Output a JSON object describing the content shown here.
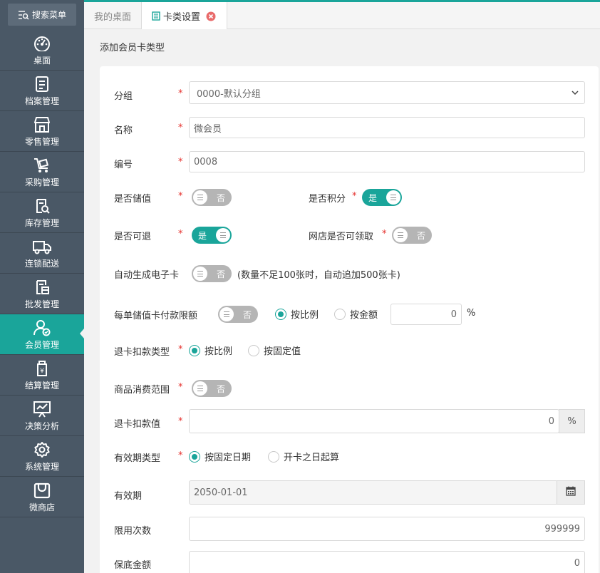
{
  "sidebar": {
    "search_label": "搜索菜单",
    "items": [
      {
        "label": "桌面",
        "icon": "dashboard-icon"
      },
      {
        "label": "档案管理",
        "icon": "archive-icon"
      },
      {
        "label": "零售管理",
        "icon": "store-icon"
      },
      {
        "label": "采购管理",
        "icon": "cart-icon"
      },
      {
        "label": "库存管理",
        "icon": "inventory-icon"
      },
      {
        "label": "连锁配送",
        "icon": "truck-icon"
      },
      {
        "label": "批发管理",
        "icon": "wholesale-icon"
      },
      {
        "label": "会员管理",
        "icon": "member-icon"
      },
      {
        "label": "结算管理",
        "icon": "settlement-icon"
      },
      {
        "label": "决策分析",
        "icon": "analysis-icon"
      },
      {
        "label": "系统管理",
        "icon": "gear-icon"
      },
      {
        "label": "微商店",
        "icon": "shop-bag-icon"
      }
    ],
    "active_index": 7
  },
  "tabs": [
    {
      "label": "我的桌面"
    },
    {
      "label": "卡类设置"
    }
  ],
  "page": {
    "subtitle": "添加会员卡类型"
  },
  "form": {
    "group": {
      "label": "分组",
      "value": "0000-默认分组"
    },
    "name": {
      "label": "名称",
      "value": "微会员"
    },
    "code": {
      "label": "编号",
      "value": "0008"
    },
    "stored_value": {
      "label": "是否储值",
      "state": "否"
    },
    "points": {
      "label": "是否积分",
      "state": "是"
    },
    "refundable": {
      "label": "是否可退",
      "state": "是"
    },
    "online_claim": {
      "label": "网店是否可领取",
      "state": "否"
    },
    "auto_ecard": {
      "label": "自动生成电子卡",
      "state": "否",
      "note": "(数量不足100张时，自动追加500张卡)"
    },
    "payment_limit": {
      "label": "每单储值卡付款限额",
      "state": "否",
      "opt_ratio": "按比例",
      "opt_amount": "按金额",
      "value": "0",
      "unit": "%"
    },
    "refund_deduct_type": {
      "label": "退卡扣款类型",
      "opt_ratio": "按比例",
      "opt_fixed": "按固定值"
    },
    "consume_scope": {
      "label": "商品消费范围",
      "state": "否"
    },
    "refund_deduct_value": {
      "label": "退卡扣款值",
      "value": "0",
      "unit": "%"
    },
    "validity_type": {
      "label": "有效期类型",
      "opt_fixed_date": "按固定日期",
      "opt_from_open": "开卡之日起算"
    },
    "validity": {
      "label": "有效期",
      "value": "2050-01-01"
    },
    "usage_limit": {
      "label": "限用次数",
      "value": "999999"
    },
    "min_balance": {
      "label": "保底金额",
      "value": "0"
    }
  },
  "colors": {
    "accent": "#1aa59a",
    "sidebar": "#4a5866",
    "required": "#e5302c"
  }
}
